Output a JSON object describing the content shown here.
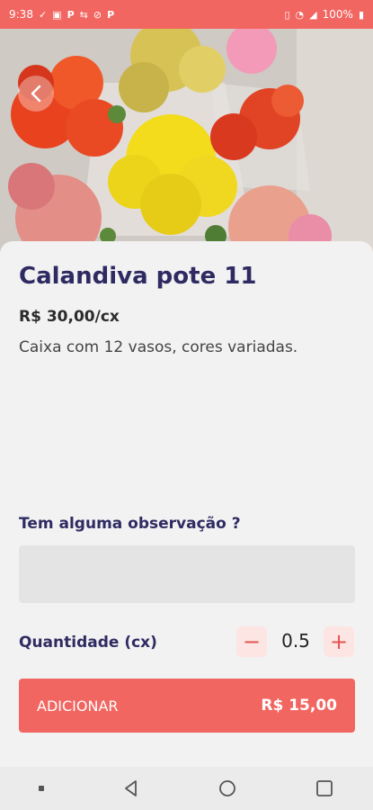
{
  "status_bar": {
    "time": "9:38",
    "left_icons": [
      "check-icon",
      "mail-icon",
      "parking-icon",
      "arrows-icon",
      "no-sim-icon",
      "parking-icon"
    ],
    "battery": "100%",
    "background": "#f26661"
  },
  "product": {
    "name": "Calandiva pote 11",
    "price": "R$ 30,00/cx",
    "description": "Caixa com 12 vasos, cores variadas."
  },
  "observation": {
    "label": "Tem alguma observação ?",
    "value": "",
    "placeholder": ""
  },
  "quantity": {
    "label": "Quantidade (cx)",
    "value": "0.5",
    "minus": "−",
    "plus": "+"
  },
  "add_button": {
    "label": "ADICIONAR",
    "total": "R$ 15,00"
  },
  "colors": {
    "accent": "#f26661",
    "title": "#2f2b62",
    "stepper_bg": "#fde5e4"
  }
}
